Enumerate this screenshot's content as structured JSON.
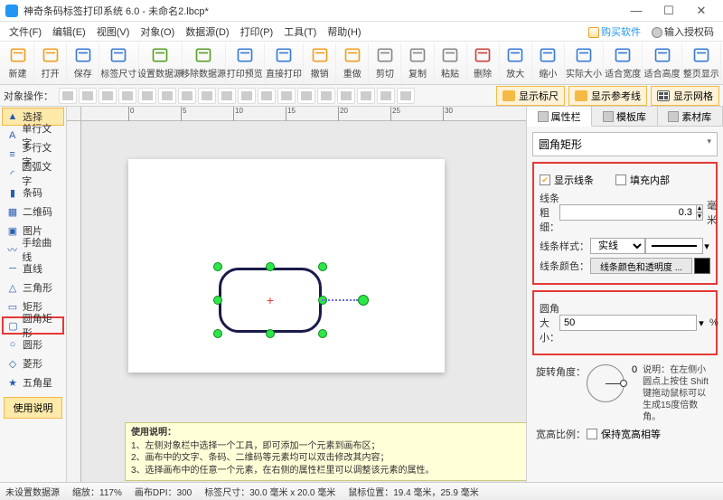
{
  "window": {
    "title": "神奇条码标签打印系统 6.0 - 未命名2.lbcp*"
  },
  "menu": {
    "items": [
      "文件(F)",
      "编辑(E)",
      "视图(V)",
      "对象(O)",
      "数据源(D)",
      "打印(P)",
      "工具(T)",
      "帮助(H)"
    ],
    "buy": "购买软件",
    "auth": "输入授权码"
  },
  "toolbar": {
    "items": [
      "新建",
      "打开",
      "保存",
      "标签尺寸",
      "设置数据源",
      "移除数据源",
      "打印预览",
      "直接打印",
      "撤销",
      "重做",
      "剪切",
      "复制",
      "粘贴",
      "删除",
      "放大",
      "缩小",
      "实际大小",
      "适合宽度",
      "适合高度",
      "整页显示"
    ]
  },
  "toolbar2": {
    "label": "对象操作：",
    "btns": [
      "显示标尺",
      "显示参考线",
      "显示网格"
    ]
  },
  "palette": {
    "items": [
      {
        "label": "选择",
        "cls": "sel-arrow"
      },
      {
        "label": "单行文字"
      },
      {
        "label": "多行文字"
      },
      {
        "label": "圆弧文字"
      },
      {
        "label": "条码"
      },
      {
        "label": "二维码"
      },
      {
        "label": "图片"
      },
      {
        "label": "手绘曲线"
      },
      {
        "label": "直线"
      },
      {
        "label": "三角形"
      },
      {
        "label": "矩形"
      },
      {
        "label": "圆角矩形",
        "cls": "highlight"
      },
      {
        "label": "圆形"
      },
      {
        "label": "菱形"
      },
      {
        "label": "五角星"
      }
    ],
    "helpbtn": "使用说明"
  },
  "ruler_ticks": [
    "0",
    "5",
    "10",
    "15",
    "20",
    "25",
    "30"
  ],
  "help": {
    "title": "使用说明：",
    "l1": "1、左侧对象栏中选择一个工具，即可添加一个元素到画布区；",
    "l2": "2、画布中的文字、条码、二维码等元素均可以双击修改其内容；",
    "l3": "3、选择画布中的任意一个元素，在右侧的属性栏里可以调整该元素的属性。"
  },
  "props": {
    "tabs": [
      "属性栏",
      "模板库",
      "素材库"
    ],
    "shape_name": "圆角矩形",
    "show_line": "显示线条",
    "fill_inside": "填充内部",
    "line_width_label": "线条粗细：",
    "line_width_value": "0.3",
    "line_width_unit": "毫米",
    "line_style_label": "线条样式：",
    "line_style_value": "实线",
    "line_color_label": "线条颜色：",
    "line_color_btn": "线条颜色和透明度 ...",
    "corner_label": "圆角大小：",
    "corner_value": "50",
    "corner_unit": "%",
    "rotate_label": "旋转角度：",
    "rotate_value": "0",
    "rotate_desc": "说明：在左侧小圆点上按住 Shift 键拖动鼠标可以生成15度倍数角。",
    "aspect_label": "宽高比例：",
    "aspect_keep": "保持宽高相等"
  },
  "status": {
    "ds": "未设置数据源",
    "zoom": "缩放：117%",
    "dpi": "画布DPI：300",
    "label_size": "标签尺寸：30.0 毫米 x 20.0 毫米",
    "cursor": "鼠标位置：19.4 毫米，25.9 毫米"
  }
}
